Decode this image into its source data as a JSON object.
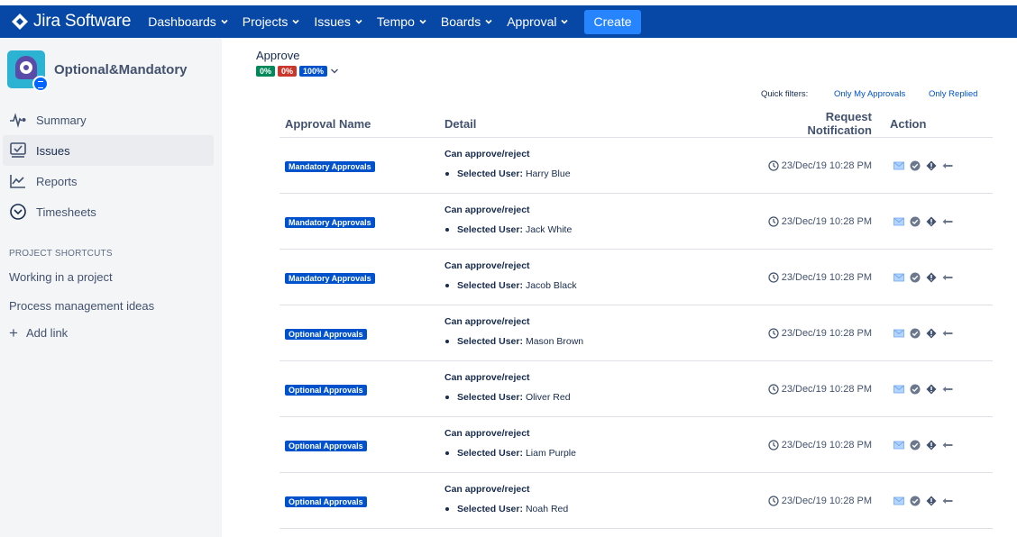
{
  "topbar": {
    "app_name": "Jira Software",
    "nav": [
      "Dashboards",
      "Projects",
      "Issues",
      "Tempo",
      "Boards",
      "Approval"
    ],
    "create_label": "Create"
  },
  "sidebar": {
    "project_name": "Optional&Mandatory",
    "items": [
      {
        "label": "Summary",
        "icon": "activity-icon"
      },
      {
        "label": "Issues",
        "icon": "issues-icon"
      },
      {
        "label": "Reports",
        "icon": "reports-icon"
      },
      {
        "label": "Timesheets",
        "icon": "clock-icon"
      }
    ],
    "shortcuts_title": "PROJECT SHORTCUTS",
    "shortcuts": [
      "Working in a project",
      "Process management ideas"
    ],
    "add_link": "Add link"
  },
  "main": {
    "title": "Approve",
    "progress": {
      "approved": "0%",
      "rejected": "0%",
      "pending": "100%"
    },
    "quick_filters_label": "Quick filters:",
    "quick_filters": [
      "Only My Approvals",
      "Only Replied"
    ],
    "columns": [
      "Approval Name",
      "Detail",
      "Request Notification",
      "Action"
    ],
    "rows": [
      {
        "name": "Mandatory Approvals",
        "detail": "Can approve/reject",
        "user_label": "Selected User:",
        "user": "Harry Blue",
        "time": "23/Dec/19 10:28 PM"
      },
      {
        "name": "Mandatory Approvals",
        "detail": "Can approve/reject",
        "user_label": "Selected User:",
        "user": "Jack White",
        "time": "23/Dec/19 10:28 PM"
      },
      {
        "name": "Mandatory Approvals",
        "detail": "Can approve/reject",
        "user_label": "Selected User:",
        "user": "Jacob Black",
        "time": "23/Dec/19 10:28 PM"
      },
      {
        "name": "Optional Approvals",
        "detail": "Can approve/reject",
        "user_label": "Selected User:",
        "user": "Mason Brown",
        "time": "23/Dec/19 10:28 PM"
      },
      {
        "name": "Optional Approvals",
        "detail": "Can approve/reject",
        "user_label": "Selected User:",
        "user": "Oliver Red",
        "time": "23/Dec/19 10:28 PM"
      },
      {
        "name": "Optional Approvals",
        "detail": "Can approve/reject",
        "user_label": "Selected User:",
        "user": "Liam Purple",
        "time": "23/Dec/19 10:28 PM"
      },
      {
        "name": "Optional Approvals",
        "detail": "Can approve/reject",
        "user_label": "Selected User:",
        "user": "Noah Red",
        "time": "23/Dec/19 10:28 PM"
      }
    ]
  },
  "colors": {
    "topbar": "#0747a6",
    "create": "#2684ff",
    "tag": "#0052cc",
    "approved": "#00875a",
    "rejected": "#c9372c"
  }
}
